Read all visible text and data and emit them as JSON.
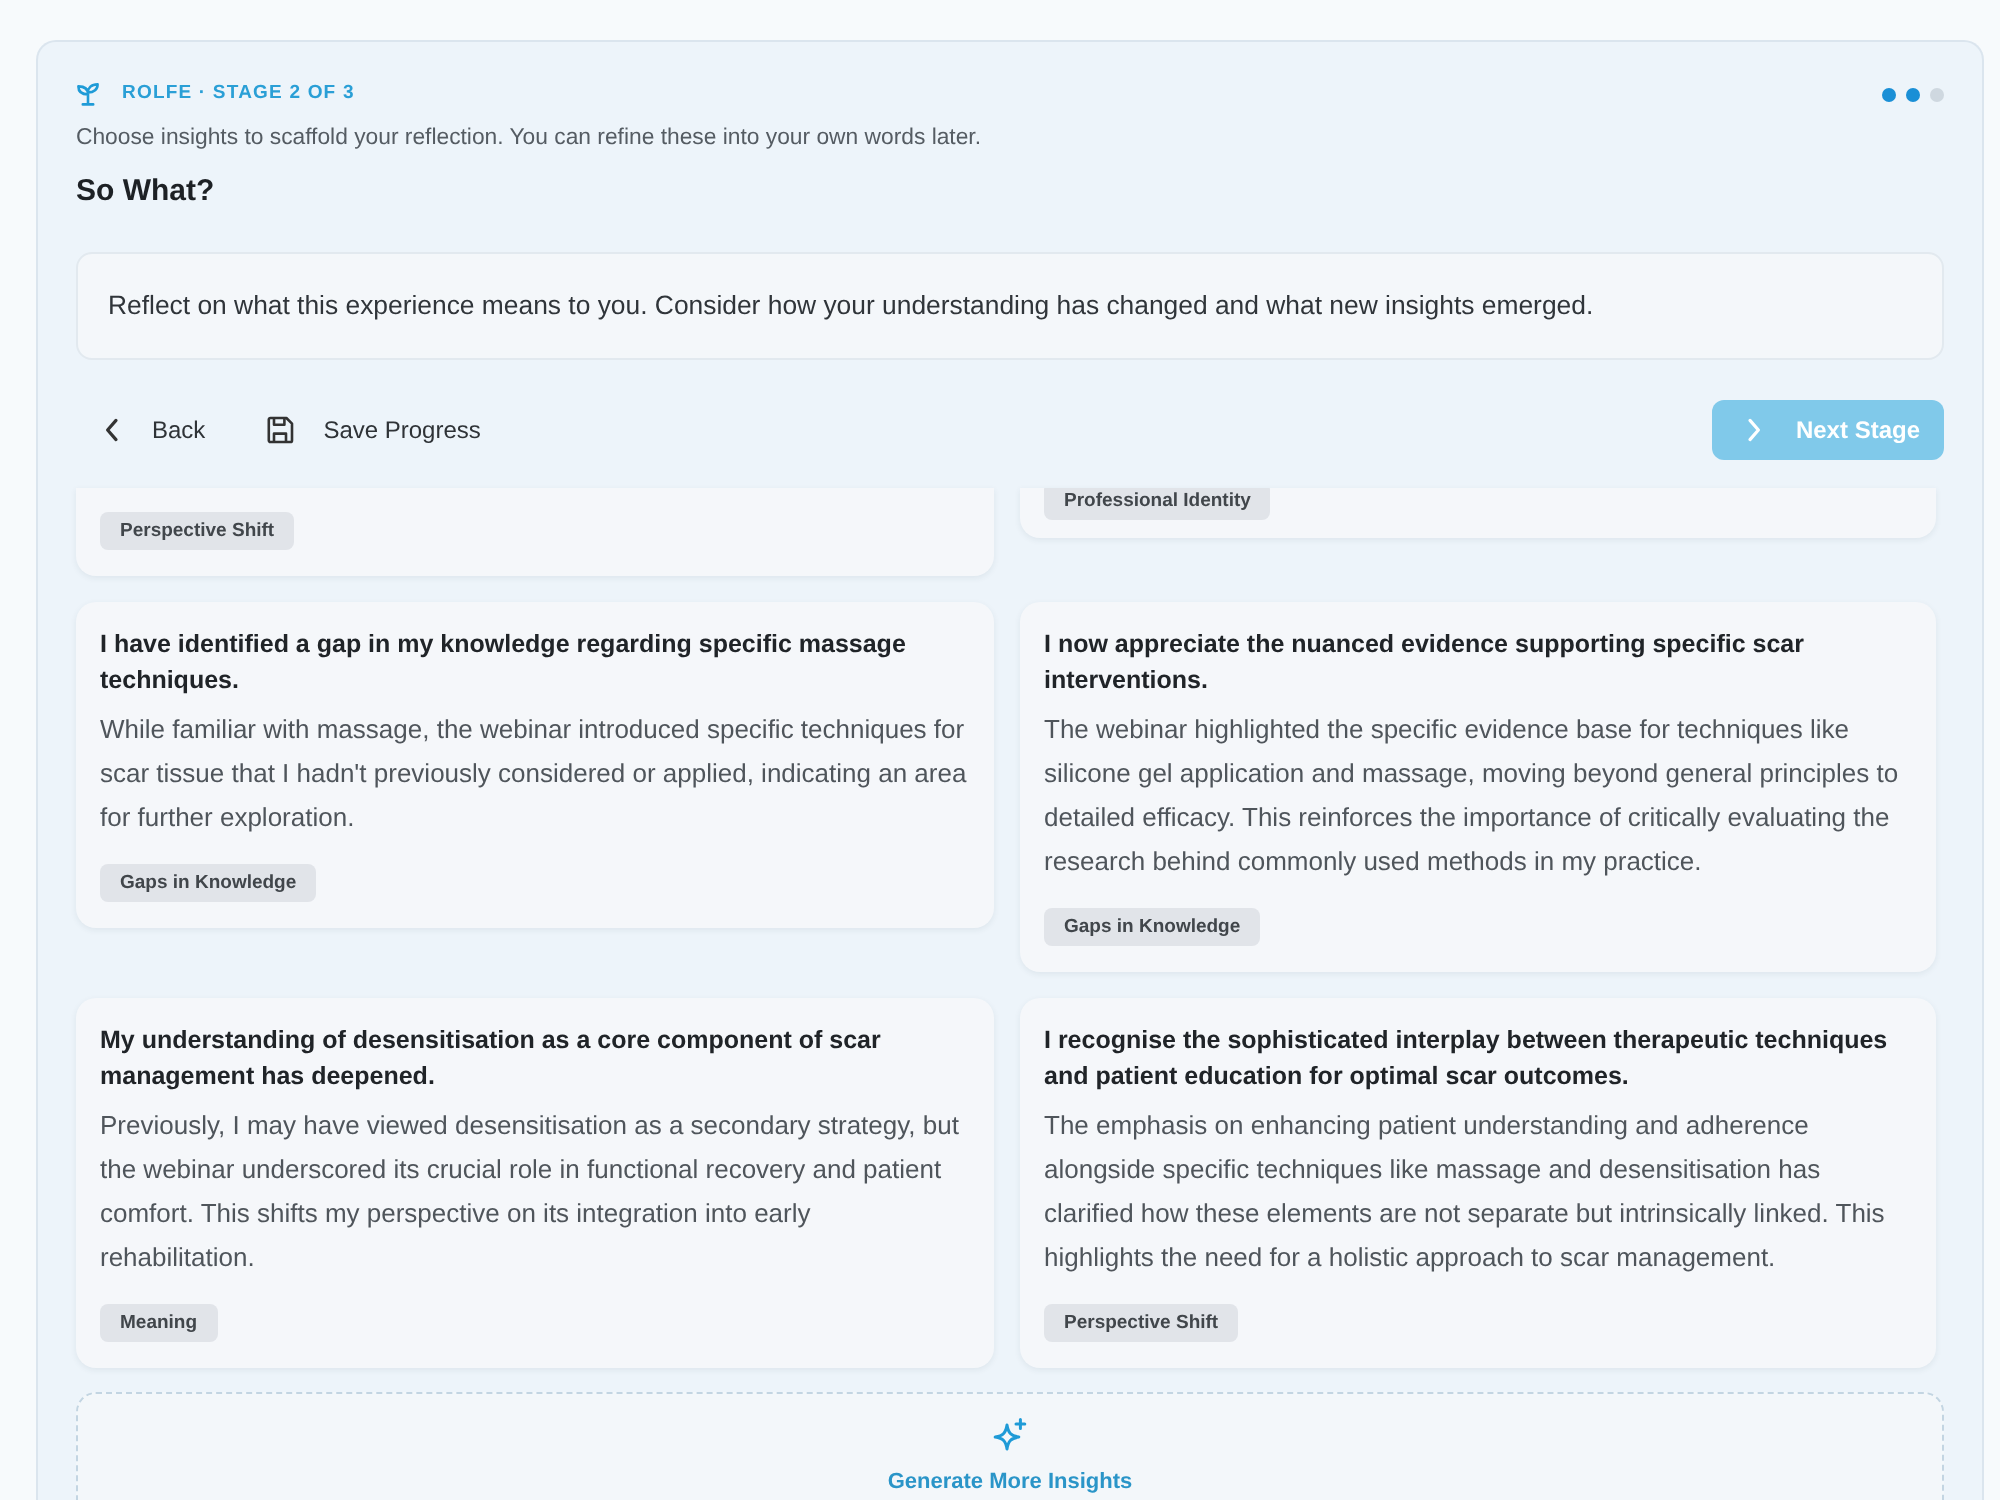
{
  "header": {
    "eyebrow": "ROLFE · STAGE 2 OF 3",
    "progress_dots": [
      {
        "active": true
      },
      {
        "active": true
      },
      {
        "active": false
      }
    ],
    "subtitle": "Choose insights to scaffold your reflection. You can refine these into your own words later.",
    "title": "So What?"
  },
  "prompt": "Reflect on what this experience means to you. Consider how your understanding has changed and what new insights emerged.",
  "toolbar": {
    "back": "Back",
    "save": "Save Progress",
    "next": {
      "label": "Next Stage",
      "disabled": true
    }
  },
  "insights": [
    {
      "tag": "Perspective Shift"
    },
    {
      "tag": "Professional Identity"
    },
    {
      "title": "I have identified a gap in my knowledge regarding specific massage techniques.",
      "body": "While familiar with massage, the webinar introduced specific techniques for scar tissue that I hadn't previously considered or applied, indicating an area for further exploration.",
      "tag": "Gaps in Knowledge"
    },
    {
      "title": "I now appreciate the nuanced evidence supporting specific scar interventions.",
      "body": "The webinar highlighted the specific evidence base for techniques like silicone gel application and massage, moving beyond general principles to detailed efficacy. This reinforces the importance of critically evaluating the research behind commonly used methods in my practice.",
      "tag": "Gaps in Knowledge"
    },
    {
      "title": "My understanding of desensitisation as a core component of scar management has deepened.",
      "body": "Previously, I may have viewed desensitisation as a secondary strategy, but the webinar underscored its crucial role in functional recovery and patient comfort. This shifts my perspective on its integration into early rehabilitation.",
      "tag": "Meaning"
    },
    {
      "title": "I recognise the sophisticated interplay between therapeutic techniques and patient education for optimal scar outcomes.",
      "body": "The emphasis on enhancing patient understanding and adherence alongside specific techniques like massage and desensitisation has clarified how these elements are not separate but intrinsically linked. This highlights the need for a holistic approach to scar management.",
      "tag": "Perspective Shift"
    }
  ],
  "generate_button": "Generate More Insights"
}
